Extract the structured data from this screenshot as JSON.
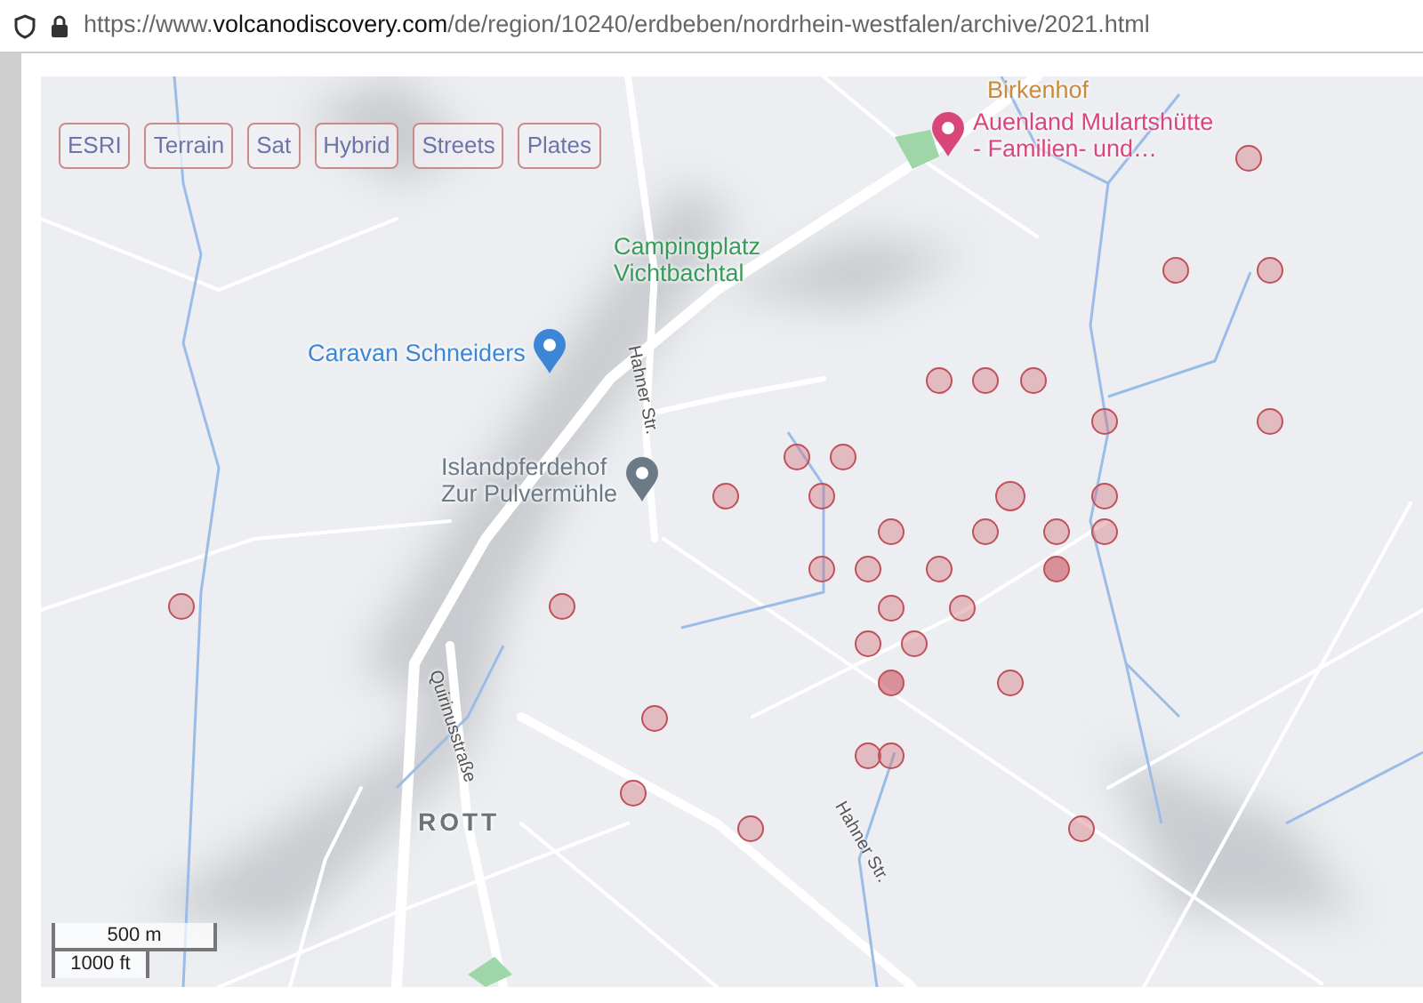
{
  "address_bar": {
    "url": {
      "scheme": "https://www.",
      "domain": "volcanodiscovery.com",
      "path": "/de/region/10240/erdbeben/nordrhein-westfalen/archive/2021.html"
    }
  },
  "map": {
    "layer_buttons": [
      {
        "label": "ESRI"
      },
      {
        "label": "Terrain"
      },
      {
        "label": "Sat"
      },
      {
        "label": "Hybrid"
      },
      {
        "label": "Streets"
      },
      {
        "label": "Plates"
      }
    ],
    "labels": [
      {
        "kind": "place",
        "text": "Birkenhof",
        "color": "#c98a3c"
      },
      {
        "kind": "poi",
        "text": "Auenland Mulartshütte\n- Familien- und…",
        "color": "#d9467a"
      },
      {
        "kind": "place",
        "text": "Campingplatz\nVichtbachtal",
        "color": "#3a9a5c"
      },
      {
        "kind": "poi",
        "text": "Caravan Schneiders",
        "color": "#3d86d6"
      },
      {
        "kind": "poi",
        "text": "Islandpferdehof\nZur Pulvermühle",
        "color": "#6b7a86"
      },
      {
        "kind": "street",
        "text": "Hahner Str."
      },
      {
        "kind": "street",
        "text": "Quirinusstraße"
      },
      {
        "kind": "town",
        "text": "ROTT"
      },
      {
        "kind": "street",
        "text": "Hahner Str."
      }
    ],
    "scale": {
      "metric": "500 m",
      "imperial": "1000 ft"
    }
  }
}
